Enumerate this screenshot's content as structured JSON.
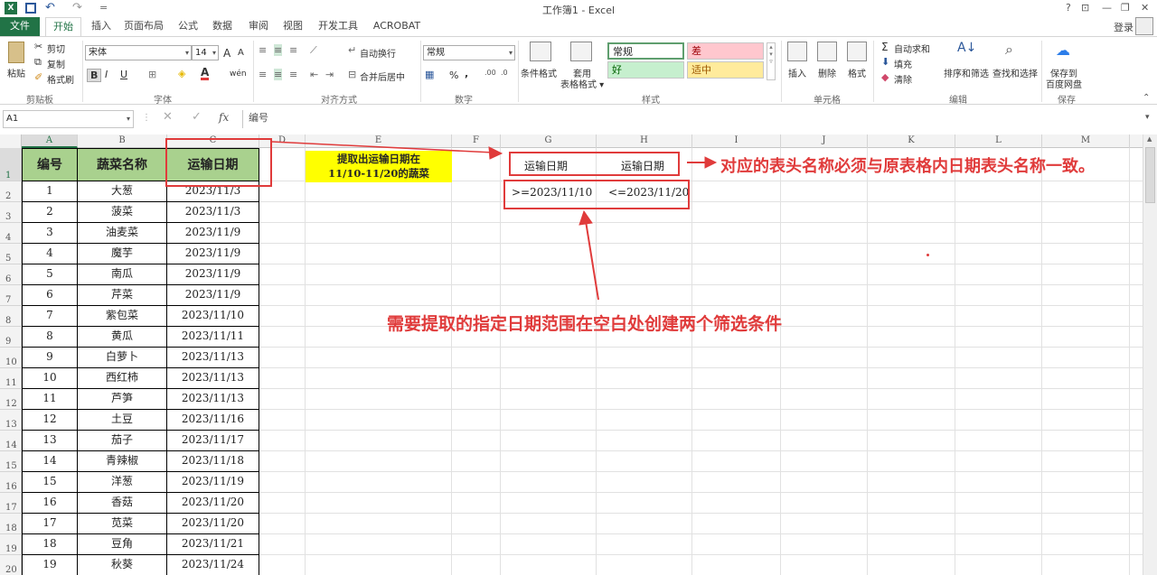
{
  "app": {
    "title": "工作簿1 - Excel",
    "logo": "X",
    "window_buttons": [
      "?",
      "⊡",
      "—",
      "❐",
      "✕"
    ],
    "login": "登录"
  },
  "tabs": [
    "文件",
    "开始",
    "插入",
    "页面布局",
    "公式",
    "数据",
    "审阅",
    "视图",
    "开发工具",
    "ACROBAT"
  ],
  "ribbon": {
    "clipboard": {
      "paste": "粘贴",
      "cut": "剪切",
      "copy": "复制",
      "format_painter": "格式刷",
      "label": "剪贴板"
    },
    "font": {
      "name": "宋体",
      "size": "14",
      "bold": "B",
      "italic": "I",
      "underline": "U",
      "label": "字体",
      "grow": "A",
      "shrink": "A",
      "font_color": "A",
      "phonetic": "wén"
    },
    "alignment": {
      "wrap": "自动换行",
      "merge": "合并后居中",
      "label": "对齐方式"
    },
    "number": {
      "format": "常规",
      "percent": "%",
      "comma": ",",
      "label": "数字"
    },
    "styles": {
      "cond": "条件格式",
      "table": "套用\n表格格式",
      "normal": "常规",
      "bad": "差",
      "good": "好",
      "neutral": "适中",
      "label": "样式"
    },
    "cells": {
      "insert": "插入",
      "delete": "删除",
      "format": "格式",
      "label": "单元格"
    },
    "editing": {
      "autosum": "自动求和",
      "fill": "填充",
      "clear": "清除",
      "sort": "排序和筛选",
      "find": "查找和选择",
      "label": "编辑"
    },
    "save": {
      "save": "保存到\n百度网盘",
      "label": "保存"
    }
  },
  "formula_bar": {
    "name_box": "A1",
    "formula": "编号",
    "fx": "fx"
  },
  "columns": [
    "A",
    "B",
    "C",
    "D",
    "E",
    "F",
    "G",
    "H",
    "I",
    "J",
    "K",
    "L",
    "M"
  ],
  "rows": [
    "1",
    "2",
    "3",
    "4",
    "5",
    "6",
    "7",
    "8",
    "9",
    "10",
    "11",
    "12",
    "13",
    "14",
    "15",
    "16",
    "17",
    "18",
    "19",
    "20"
  ],
  "table": {
    "headers": [
      "编号",
      "蔬菜名称",
      "运输日期"
    ],
    "rows": [
      [
        "1",
        "大葱",
        "2023/11/3"
      ],
      [
        "2",
        "菠菜",
        "2023/11/3"
      ],
      [
        "3",
        "油麦菜",
        "2023/11/9"
      ],
      [
        "4",
        "魔芋",
        "2023/11/9"
      ],
      [
        "5",
        "南瓜",
        "2023/11/9"
      ],
      [
        "6",
        "芹菜",
        "2023/11/9"
      ],
      [
        "7",
        "紫包菜",
        "2023/11/10"
      ],
      [
        "8",
        "黄瓜",
        "2023/11/11"
      ],
      [
        "9",
        "白萝卜",
        "2023/11/13"
      ],
      [
        "10",
        "西红柿",
        "2023/11/13"
      ],
      [
        "11",
        "芦笋",
        "2023/11/13"
      ],
      [
        "12",
        "土豆",
        "2023/11/16"
      ],
      [
        "13",
        "茄子",
        "2023/11/17"
      ],
      [
        "14",
        "青辣椒",
        "2023/11/18"
      ],
      [
        "15",
        "洋葱",
        "2023/11/19"
      ],
      [
        "16",
        "香菇",
        "2023/11/20"
      ],
      [
        "17",
        "苋菜",
        "2023/11/20"
      ],
      [
        "18",
        "豆角",
        "2023/11/21"
      ],
      [
        "19",
        "秋葵",
        "2023/11/24"
      ]
    ]
  },
  "criteria": {
    "header1": "运输日期",
    "header2": "运输日期",
    "cond1": ">=2023/11/10",
    "cond2": "<=2023/11/20"
  },
  "annotations": {
    "yellow_note_line1": "提取出运输日期在",
    "yellow_note_line2": "11/10-11/20的蔬菜",
    "header_note": "对应的表头名称必须与原表格内日期表头名称一致。",
    "criteria_note": "需要提取的指定日期范围在空白处创建两个筛选条件"
  }
}
